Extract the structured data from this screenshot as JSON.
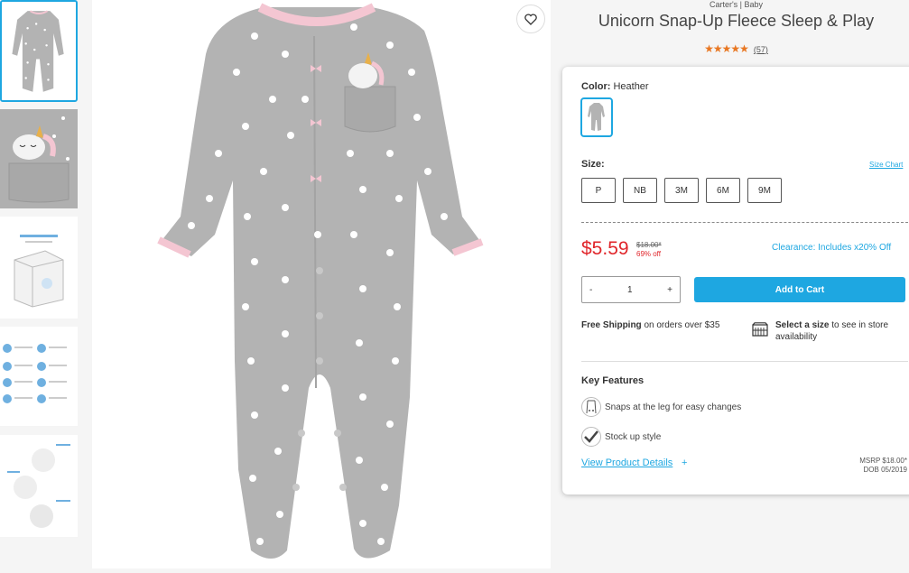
{
  "product": {
    "brand": "Carter's | Baby",
    "title": "Unicorn Snap-Up Fleece Sleep & Play",
    "stars": "★★★★★",
    "review_count": "(57)"
  },
  "color": {
    "label": "Color:",
    "value": "Heather"
  },
  "size": {
    "label": "Size:",
    "chart_link": "Size Chart",
    "options": [
      "P",
      "NB",
      "3M",
      "6M",
      "9M"
    ]
  },
  "pricing": {
    "sale_price": "$5.59",
    "original_price": "$18.00*",
    "percent_off": "69% off",
    "clearance": "Clearance: Includes x20% Off"
  },
  "cart": {
    "minus": "-",
    "quantity": "1",
    "plus": "+",
    "add_label": "Add to Cart"
  },
  "shipping": {
    "bold": "Free Shipping",
    "rest": " on orders over $35"
  },
  "store": {
    "bold": "Select a size",
    "rest": " to see in store availability"
  },
  "features": {
    "title": "Key Features",
    "items": [
      "Snaps at the leg for easy changes",
      "Stock up style"
    ]
  },
  "details": {
    "link": "View Product Details",
    "plus": "+",
    "msrp": "MSRP $18.00*",
    "dob": "DOB 05/2019"
  },
  "colors": {
    "accent": "#1ea7e1",
    "sale": "#e0262b",
    "stars": "#e87722",
    "garment": "#b3b3b3",
    "trim": "#f4c6d2"
  },
  "thumbnails": [
    "onesie-front",
    "unicorn-pocket-closeup",
    "make-it-a-gift",
    "size-chart-graphic",
    "features-graphic"
  ]
}
